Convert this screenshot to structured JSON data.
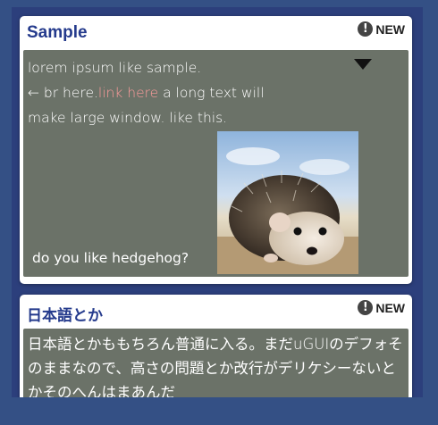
{
  "cards": [
    {
      "title": "Sample",
      "badge": "NEW",
      "body": {
        "line1": "lorem ipsum like sample.",
        "line2_prefix": "← br here.",
        "link": "link here",
        "line2_suffix": " a long text will",
        "line3": "make large window. like this.",
        "caption": "do you like hedgehog?"
      }
    },
    {
      "title": "日本語とか",
      "badge": "NEW",
      "body": {
        "text": "日本語とかももちろん普通に入る。まだuGUIのデフォそのままなので、高さの問題とか改行がデリケシーないとかそのへんはまあんだ"
      }
    }
  ],
  "colors": {
    "background": "#345085",
    "title": "#243a8c",
    "body_bg": "#6b7268",
    "link": "#ff9c9c"
  }
}
